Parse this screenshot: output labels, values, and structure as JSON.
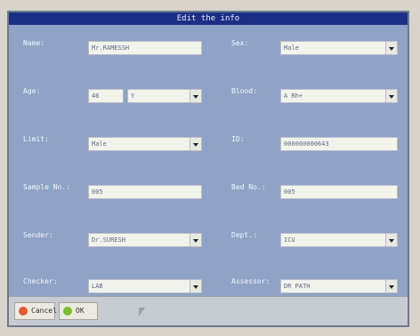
{
  "dialog": {
    "title": "Edit the info"
  },
  "fields": {
    "name": {
      "label": "Name:",
      "value": "Mr.RAMESSH"
    },
    "sex": {
      "label": "Sex:",
      "value": "Male"
    },
    "age": {
      "label": "Age:",
      "value": "46",
      "unit": "Y"
    },
    "blood": {
      "label": "Blood:",
      "value": "A Rh+"
    },
    "limit": {
      "label": "Limit:",
      "value": "Male"
    },
    "id": {
      "label": "ID:",
      "value": "000000000643"
    },
    "sample_no": {
      "label": "Sample No.:",
      "value": "005"
    },
    "bed_no": {
      "label": "Bed No.:",
      "value": "005"
    },
    "sender": {
      "label": "Sender:",
      "value": "Dr.SURESH"
    },
    "dept": {
      "label": "Dept.:",
      "value": "ICU"
    },
    "checker": {
      "label": "Checker:",
      "value": "LAB"
    },
    "assessor": {
      "label": "Assessor:",
      "value": "DR PATH"
    }
  },
  "buttons": {
    "cancel_label": "Cancel",
    "ok_label": "OK"
  },
  "colors": {
    "title_bar": "#1c2f86",
    "panel_bg": "#8fa3c6",
    "cancel_icon": "#e25b2d",
    "ok_icon": "#7bbf2c"
  }
}
